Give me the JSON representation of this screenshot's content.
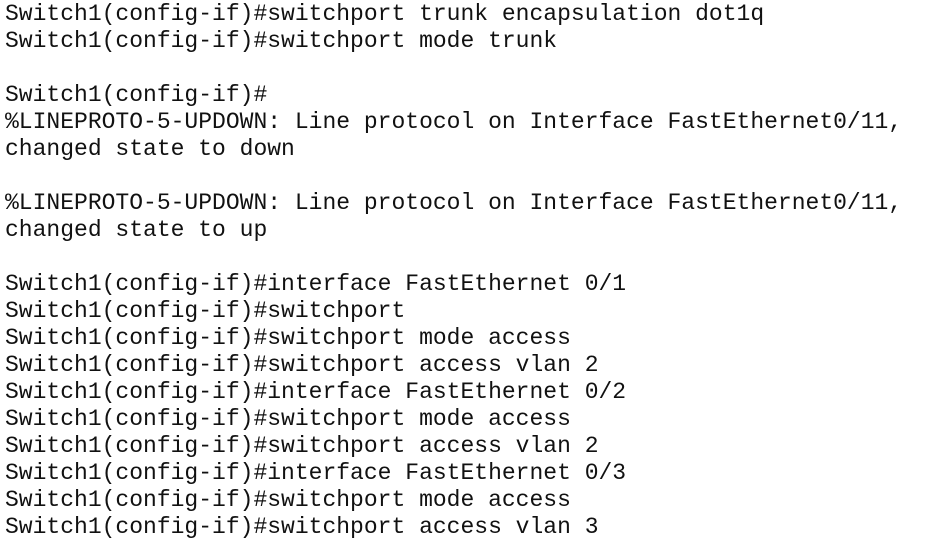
{
  "terminal": {
    "lines": [
      "Switch1(config-if)#switchport trunk encapsulation dot1q",
      "Switch1(config-if)#switchport mode trunk",
      "",
      "Switch1(config-if)#",
      "%LINEPROTO-5-UPDOWN: Line protocol on Interface FastEthernet0/11,",
      "changed state to down",
      "",
      "%LINEPROTO-5-UPDOWN: Line protocol on Interface FastEthernet0/11,",
      "changed state to up",
      "",
      "Switch1(config-if)#interface FastEthernet 0/1",
      "Switch1(config-if)#switchport",
      "Switch1(config-if)#switchport mode access",
      "Switch1(config-if)#switchport access vlan 2",
      "Switch1(config-if)#interface FastEthernet 0/2",
      "Switch1(config-if)#switchport mode access",
      "Switch1(config-if)#switchport access vlan 2",
      "Switch1(config-if)#interface FastEthernet 0/3",
      "Switch1(config-if)#switchport mode access",
      "Switch1(config-if)#switchport access vlan 3"
    ]
  }
}
